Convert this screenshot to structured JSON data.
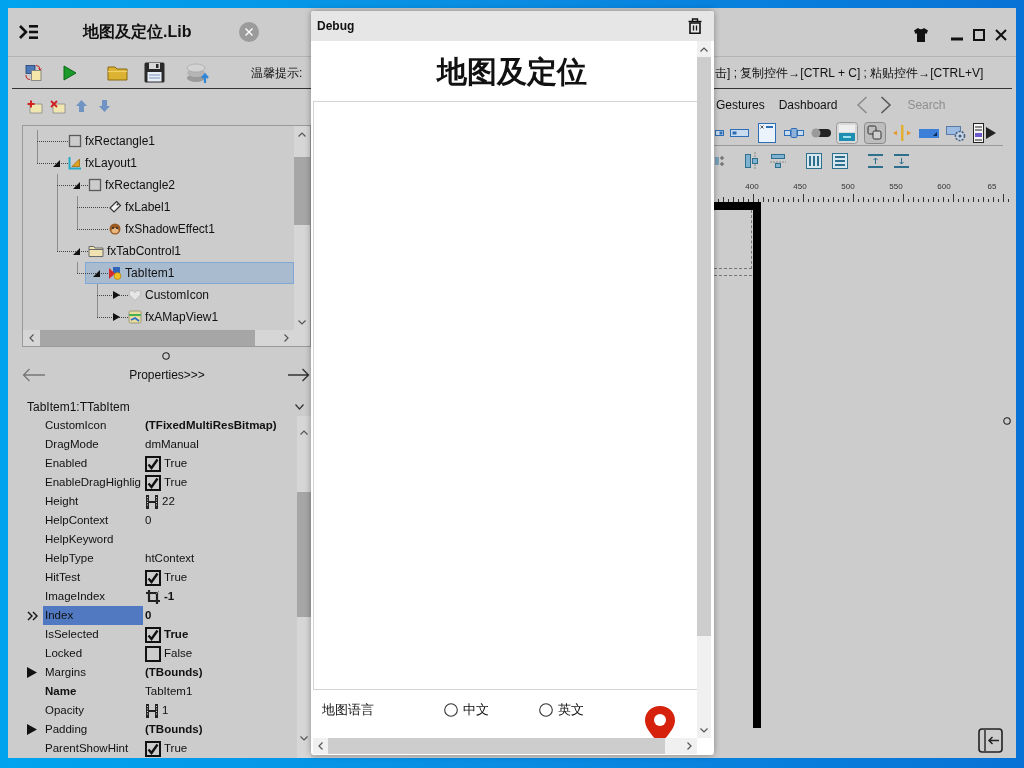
{
  "designer": {
    "title": "地图及定位.Lib",
    "hint_label": "温馨提示:",
    "hint_text": "击] ; 复制控件→[CTRL + C] ; 粘贴控件→[CTRL+V]",
    "structure_tree": [
      {
        "label": "fxRectangle1",
        "kind": "rectangle",
        "selected": false
      },
      {
        "label": "fxLayout1",
        "kind": "layout",
        "selected": false,
        "expanded": true,
        "children": [
          {
            "label": "fxRectangle2",
            "kind": "rectangle",
            "selected": false,
            "expanded": true,
            "children": [
              {
                "label": "fxLabel1",
                "kind": "label",
                "selected": false
              },
              {
                "label": "fxShadowEffect1",
                "kind": "effect",
                "selected": false
              }
            ]
          },
          {
            "label": "fxTabControl1",
            "kind": "tab_control",
            "selected": false,
            "expanded": true,
            "children": [
              {
                "label": "TabItem1",
                "kind": "tab_item",
                "selected": true,
                "expanded": true,
                "children": [
                  {
                    "label": "CustomIcon",
                    "kind": "icon",
                    "selected": false,
                    "expanded": false
                  },
                  {
                    "label": "fxAMapView1",
                    "kind": "map",
                    "selected": false,
                    "expanded": false
                  }
                ]
              }
            ]
          }
        ]
      }
    ],
    "pane_switch": "Properties>>>",
    "object_selector": "TabItem1:TTabItem",
    "properties": [
      {
        "name": "CustomIcon",
        "value": "(TFixedMultiResBitmap)",
        "kind": "text",
        "name_bold": false,
        "value_bold": true,
        "selected": false
      },
      {
        "name": "DragMode",
        "value": "dmManual",
        "kind": "text",
        "name_bold": false,
        "value_bold": false,
        "selected": false
      },
      {
        "name": "Enabled",
        "value": "True",
        "kind": "checkbox",
        "checked": true,
        "name_bold": false,
        "value_bold": false,
        "selected": false
      },
      {
        "name": "EnableDragHighlig",
        "value": "True",
        "kind": "checkbox",
        "checked": true,
        "name_bold": false,
        "value_bold": false,
        "selected": false
      },
      {
        "name": "Height",
        "value": "22",
        "kind": "size",
        "name_bold": false,
        "value_bold": false,
        "selected": false
      },
      {
        "name": "HelpContext",
        "value": "0",
        "kind": "text",
        "name_bold": false,
        "value_bold": false,
        "selected": false
      },
      {
        "name": "HelpKeyword",
        "kind": "text",
        "name_bold": false,
        "selected": false
      },
      {
        "name": "HelpType",
        "value": "htContext",
        "kind": "text",
        "name_bold": false,
        "value_bold": false,
        "selected": false
      },
      {
        "name": "HitTest",
        "value": "True",
        "kind": "checkbox",
        "checked": true,
        "name_bold": false,
        "value_bold": false,
        "selected": false
      },
      {
        "name": "ImageIndex",
        "value": "-1",
        "kind": "image_index",
        "name_bold": false,
        "value_bold": true,
        "selected": false
      },
      {
        "name": "Index",
        "value": "0",
        "kind": "text",
        "name_bold": false,
        "value_bold": true,
        "selected": true
      },
      {
        "name": "IsSelected",
        "value": "True",
        "kind": "checkbox",
        "checked": true,
        "name_bold": false,
        "value_bold": true,
        "selected": false
      },
      {
        "name": "Locked",
        "value": "False",
        "kind": "checkbox",
        "checked": false,
        "name_bold": false,
        "value_bold": false,
        "selected": false
      },
      {
        "name": "Margins",
        "value": "(TBounds)",
        "kind": "group",
        "expanded": false,
        "name_bold": false,
        "value_bold": true,
        "selected": false
      },
      {
        "name": "Name",
        "value": "TabItem1",
        "kind": "text",
        "name_bold": true,
        "value_bold": false,
        "selected": false
      },
      {
        "name": "Opacity",
        "value": "1",
        "kind": "size",
        "name_bold": false,
        "value_bold": false,
        "selected": false
      },
      {
        "name": "Padding",
        "value": "(TBounds)",
        "kind": "group",
        "expanded": false,
        "name_bold": false,
        "value_bold": true,
        "selected": false
      },
      {
        "name": "ParentShowHint",
        "value": "True",
        "kind": "checkbox",
        "checked": true,
        "name_bold": false,
        "value_bold": false,
        "selected": false
      }
    ],
    "palette_tabs": [
      {
        "label": "Gestures",
        "selected": false
      },
      {
        "label": "Dashboard",
        "selected": false
      }
    ],
    "palette_search": {
      "placeholder": "Search"
    },
    "ruler_labels": [
      "400",
      "450",
      "500",
      "550",
      "600",
      "65"
    ]
  },
  "debug_window": {
    "title": "Debug",
    "heading": "地图及定位",
    "settings": [
      {
        "label": "地图语言",
        "options": [
          {
            "label": "中文",
            "selected": false
          },
          {
            "label": "英文",
            "selected": false
          }
        ]
      }
    ]
  }
}
